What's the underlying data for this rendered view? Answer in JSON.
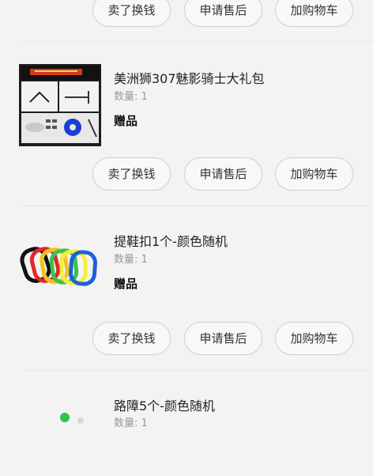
{
  "actions": {
    "sell": "卖了换钱",
    "after_sale": "申请售后",
    "add_cart": "加购物车"
  },
  "items": [
    {
      "title": "美洲狮307魅影骑士大礼包",
      "qty": "数量: 1",
      "tag": "赠品"
    },
    {
      "title": "提鞋扣1个-颜色随机",
      "qty": "数量: 1",
      "tag": "赠品"
    },
    {
      "title": "路障5个-颜色随机",
      "qty": "数量: 1"
    }
  ]
}
